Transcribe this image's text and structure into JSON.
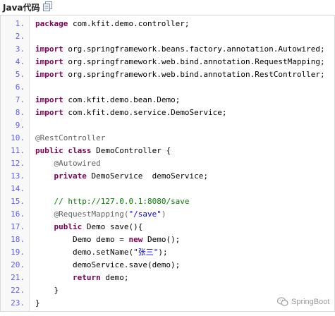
{
  "header": {
    "title": "Java代码",
    "copy_icon": "copy-icon"
  },
  "watermark": {
    "text": "SpringBoot",
    "icon": "wechat-icon"
  },
  "colors": {
    "keyword": "#7f0055",
    "annotation": "#646464",
    "comment": "#008200",
    "string": "#0000ff",
    "line_number": "#5c5cff"
  },
  "code": {
    "lines": [
      {
        "n": "1.",
        "tokens": [
          {
            "t": "package",
            "k": "keyword"
          },
          {
            "t": " com.kfit.demo.controller;",
            "k": "plain"
          }
        ]
      },
      {
        "n": "2.",
        "tokens": []
      },
      {
        "n": "3.",
        "tokens": [
          {
            "t": "import",
            "k": "keyword"
          },
          {
            "t": " org.springframework.beans.factory.annotation.Autowired;",
            "k": "plain"
          }
        ]
      },
      {
        "n": "4.",
        "tokens": [
          {
            "t": "import",
            "k": "keyword"
          },
          {
            "t": " org.springframework.web.bind.annotation.RequestMapping;",
            "k": "plain"
          }
        ]
      },
      {
        "n": "5.",
        "tokens": [
          {
            "t": "import",
            "k": "keyword"
          },
          {
            "t": " org.springframework.web.bind.annotation.RestController;",
            "k": "plain"
          }
        ]
      },
      {
        "n": "6.",
        "tokens": []
      },
      {
        "n": "7.",
        "tokens": [
          {
            "t": "import",
            "k": "keyword"
          },
          {
            "t": " com.kfit.demo.bean.Demo;",
            "k": "plain"
          }
        ]
      },
      {
        "n": "8.",
        "tokens": [
          {
            "t": "import",
            "k": "keyword"
          },
          {
            "t": " com.kfit.demo.service.DemoService;",
            "k": "plain"
          }
        ]
      },
      {
        "n": "9.",
        "tokens": []
      },
      {
        "n": "10.",
        "tokens": [
          {
            "t": "@RestController",
            "k": "annotation"
          }
        ]
      },
      {
        "n": "11.",
        "tokens": [
          {
            "t": "public",
            "k": "keyword"
          },
          {
            "t": " ",
            "k": "plain"
          },
          {
            "t": "class",
            "k": "keyword"
          },
          {
            "t": " DemoController {",
            "k": "plain"
          }
        ]
      },
      {
        "n": "12.",
        "tokens": [
          {
            "t": "    ",
            "k": "plain"
          },
          {
            "t": "@Autowired",
            "k": "annotation"
          }
        ]
      },
      {
        "n": "13.",
        "tokens": [
          {
            "t": "    ",
            "k": "plain"
          },
          {
            "t": "private",
            "k": "keyword"
          },
          {
            "t": " DemoService  demoService;",
            "k": "plain"
          }
        ]
      },
      {
        "n": "14.",
        "tokens": []
      },
      {
        "n": "15.",
        "tokens": [
          {
            "t": "    ",
            "k": "plain"
          },
          {
            "t": "// http://127.0.0.1:8080/save",
            "k": "comment"
          }
        ]
      },
      {
        "n": "16.",
        "tokens": [
          {
            "t": "    ",
            "k": "plain"
          },
          {
            "t": "@RequestMapping(",
            "k": "annotation"
          },
          {
            "t": "\"/save\"",
            "k": "string"
          },
          {
            "t": ")",
            "k": "annotation"
          }
        ]
      },
      {
        "n": "17.",
        "tokens": [
          {
            "t": "    ",
            "k": "plain"
          },
          {
            "t": "public",
            "k": "keyword"
          },
          {
            "t": " Demo save(){",
            "k": "plain"
          }
        ]
      },
      {
        "n": "18.",
        "tokens": [
          {
            "t": "        Demo demo = ",
            "k": "plain"
          },
          {
            "t": "new",
            "k": "keyword"
          },
          {
            "t": " Demo();",
            "k": "plain"
          }
        ]
      },
      {
        "n": "19.",
        "tokens": [
          {
            "t": "        demo.setName(",
            "k": "plain"
          },
          {
            "t": "\"张三\"",
            "k": "string"
          },
          {
            "t": ");",
            "k": "plain"
          }
        ]
      },
      {
        "n": "20.",
        "tokens": [
          {
            "t": "        demoService.save(demo);",
            "k": "plain"
          }
        ]
      },
      {
        "n": "21.",
        "tokens": [
          {
            "t": "        ",
            "k": "plain"
          },
          {
            "t": "return",
            "k": "keyword"
          },
          {
            "t": " demo;",
            "k": "plain"
          }
        ]
      },
      {
        "n": "22.",
        "tokens": [
          {
            "t": "    }",
            "k": "plain"
          }
        ]
      },
      {
        "n": "23.",
        "tokens": [
          {
            "t": "}",
            "k": "plain"
          }
        ]
      }
    ]
  }
}
